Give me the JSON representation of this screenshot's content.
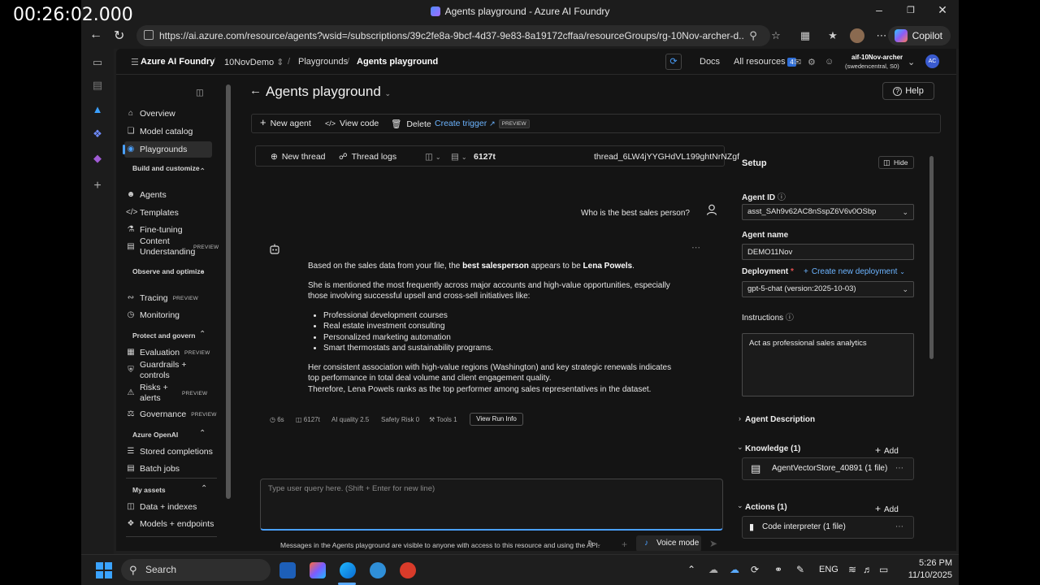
{
  "recording_timestamp": "00:26:02.000",
  "browser": {
    "window_title": "Agents playground - Azure AI Foundry",
    "url": "https://ai.azure.com/resource/agents?wsid=/subscriptions/39c2fe8a-9bcf-4d37-9e83-8a19172cffaa/resourceGroups/rg-10Nov-archer-d...",
    "copilot_label": "Copilot"
  },
  "header": {
    "brand": "Azure AI Foundry",
    "project": "10NovDemo",
    "breadcrumb_parent": "Playgrounds",
    "breadcrumb_current": "Agents playground",
    "docs": "Docs",
    "all_resources": "All resources",
    "notification_count": "4",
    "account_name": "aif-10Nov-archer",
    "account_region": "(swedencentral, S0)",
    "avatar_initials": "AC"
  },
  "nav": {
    "overview": "Overview",
    "model_catalog": "Model catalog",
    "playgrounds": "Playgrounds",
    "build_section": "Build and customize",
    "agents": "Agents",
    "templates": "Templates",
    "fine_tuning": "Fine-tuning",
    "content_understanding": "Content Understanding",
    "observe_section": "Observe and optimize",
    "tracing": "Tracing",
    "monitoring": "Monitoring",
    "protect_section": "Protect and govern",
    "evaluation": "Evaluation",
    "guardrails": "Guardrails + controls",
    "risks": "Risks + alerts",
    "governance": "Governance",
    "openai_section": "Azure OpenAI",
    "stored_completions": "Stored completions",
    "batch_jobs": "Batch jobs",
    "assets_section": "My assets",
    "data_indexes": "Data + indexes",
    "models_endpoints": "Models + endpoints",
    "preview_tag": "PREVIEW"
  },
  "page": {
    "title": "Agents playground",
    "help": "Help",
    "toolbar": {
      "new_agent": "New agent",
      "view_code": "View code",
      "delete": "Delete",
      "create_trigger": "Create trigger",
      "preview_badge": "PREVIEW"
    }
  },
  "chat": {
    "new_thread": "New thread",
    "thread_logs": "Thread logs",
    "token_count": "6127t",
    "thread_id": "thread_6LW4jYYGHdVL199ghtNrNZgf",
    "user_message": "Who is the best sales person?",
    "reply": {
      "p1_pre": "Based on the sales data from your file, the ",
      "p1_bold1": "best salesperson",
      "p1_mid": " appears to be ",
      "p1_bold2": "Lena Powels",
      "p1_end": ".",
      "p2": "She is mentioned the most frequently across major accounts and high-value opportunities, especially those involving successful upsell and cross-sell initiatives like:",
      "bullets": [
        "Professional development courses",
        "Real estate investment consulting",
        "Personalized marketing automation",
        "Smart thermostats and sustainability programs."
      ],
      "p3": "Her consistent association with high-value regions (Washington) and key strategic renewals indicates top performance in total deal volume and client engagement quality.",
      "p4": "Therefore, Lena Powels ranks as the top performer among sales representatives in the dataset."
    },
    "meta": {
      "time": "6s",
      "tokens": "6127t",
      "ai_quality": "AI quality 2.5",
      "safety_risk": "Safety Risk 0",
      "tools": "Tools 1",
      "run_info": "View Run Info"
    },
    "composer_placeholder": "Type user query here. (Shift + Enter for new line)",
    "disclaimer": "Messages in the Agents playground are visible to anyone with access to this resource and using the API.",
    "voice_mode": "Voice mode"
  },
  "setup": {
    "title": "Setup",
    "hide": "Hide",
    "agent_id_label": "Agent ID",
    "agent_id_value": "asst_SAh9v62AC8nSspZ6V6v0OSbp",
    "agent_name_label": "Agent name",
    "agent_name_value": "DEMO11Nov",
    "deployment_label": "Deployment",
    "required_mark": "*",
    "create_deployment": "Create new deployment",
    "deployment_value": "gpt-5-chat (version:2025-10-03)",
    "instructions_label": "Instructions",
    "instructions_value": "Act as professional sales analytics",
    "agent_description": "Agent Description",
    "knowledge": "Knowledge (1)",
    "add": "Add",
    "knowledge_file": "AgentVectorStore_40891 (1 file)",
    "actions": "Actions (1)",
    "action_item": "Code interpreter (1 file)"
  },
  "taskbar": {
    "search": "Search",
    "language": "ENG",
    "time": "5:26 PM",
    "date": "11/10/2025"
  }
}
